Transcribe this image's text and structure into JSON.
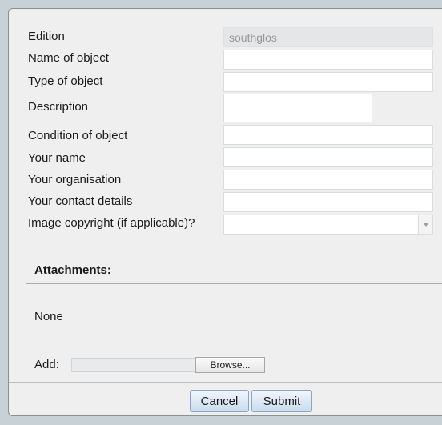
{
  "form": {
    "fields": [
      {
        "label": "Edition",
        "value": "southglos"
      },
      {
        "label": "Name of object",
        "value": ""
      },
      {
        "label": "Type of object",
        "value": ""
      },
      {
        "label": "Description",
        "value": ""
      },
      {
        "label": "Condition of object",
        "value": ""
      },
      {
        "label": "Your name",
        "value": ""
      },
      {
        "label": "Your organisation",
        "value": ""
      },
      {
        "label": "Your contact details",
        "value": ""
      },
      {
        "label": "Image copyright (if applicable)?",
        "value": ""
      }
    ],
    "attachments": {
      "title": "Attachments:",
      "status": "None",
      "add_label": "Add:",
      "browse_label": "Browse..."
    },
    "buttons": {
      "cancel_label": "Cancel",
      "submit_label": "Submit"
    },
    "icons": {
      "dropdown": "chevron-down-icon"
    }
  }
}
